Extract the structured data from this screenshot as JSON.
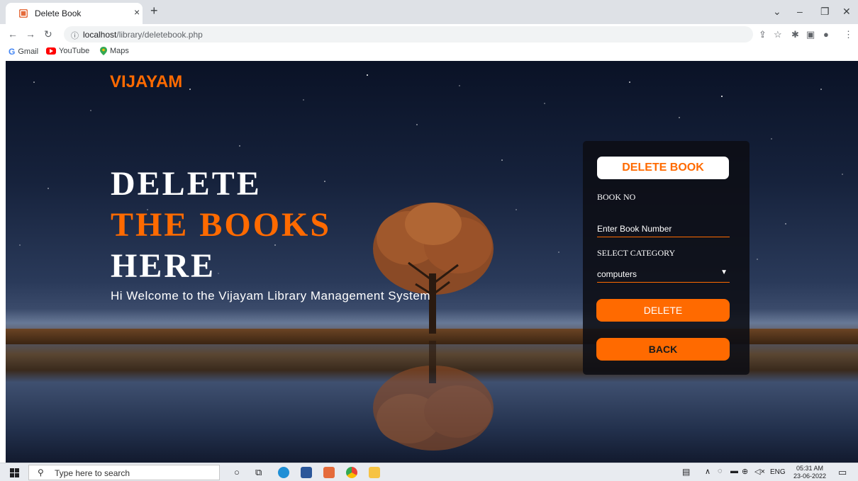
{
  "browser": {
    "tab_title": "Delete Book",
    "tab_close": "×",
    "new_tab": "+",
    "url_host": "localhost",
    "url_path": "/library/deletebook.php",
    "bookmarks": [
      "Gmail",
      "YouTube",
      "Maps"
    ]
  },
  "page": {
    "brand": "VIJAYAM",
    "hero": [
      "DELETE",
      "THE BOOKS",
      "HERE"
    ],
    "welcome": "Hi Welcome to the Vijayam Library Management System",
    "form": {
      "title": "DELETE BOOK",
      "book_no_label": "BOOK NO",
      "book_no_placeholder": "Enter Book Number",
      "category_label": "SELECT CATEGORY",
      "category_value": "computers",
      "delete_label": "DELETE",
      "back_label": "BACK"
    }
  },
  "taskbar": {
    "search_placeholder": "Type here to search",
    "lang": "ENG",
    "time": "05:31 AM",
    "date": "23-06-2022"
  },
  "colors": {
    "accent": "#ff6a00",
    "card_bg": "#0c0e14"
  }
}
